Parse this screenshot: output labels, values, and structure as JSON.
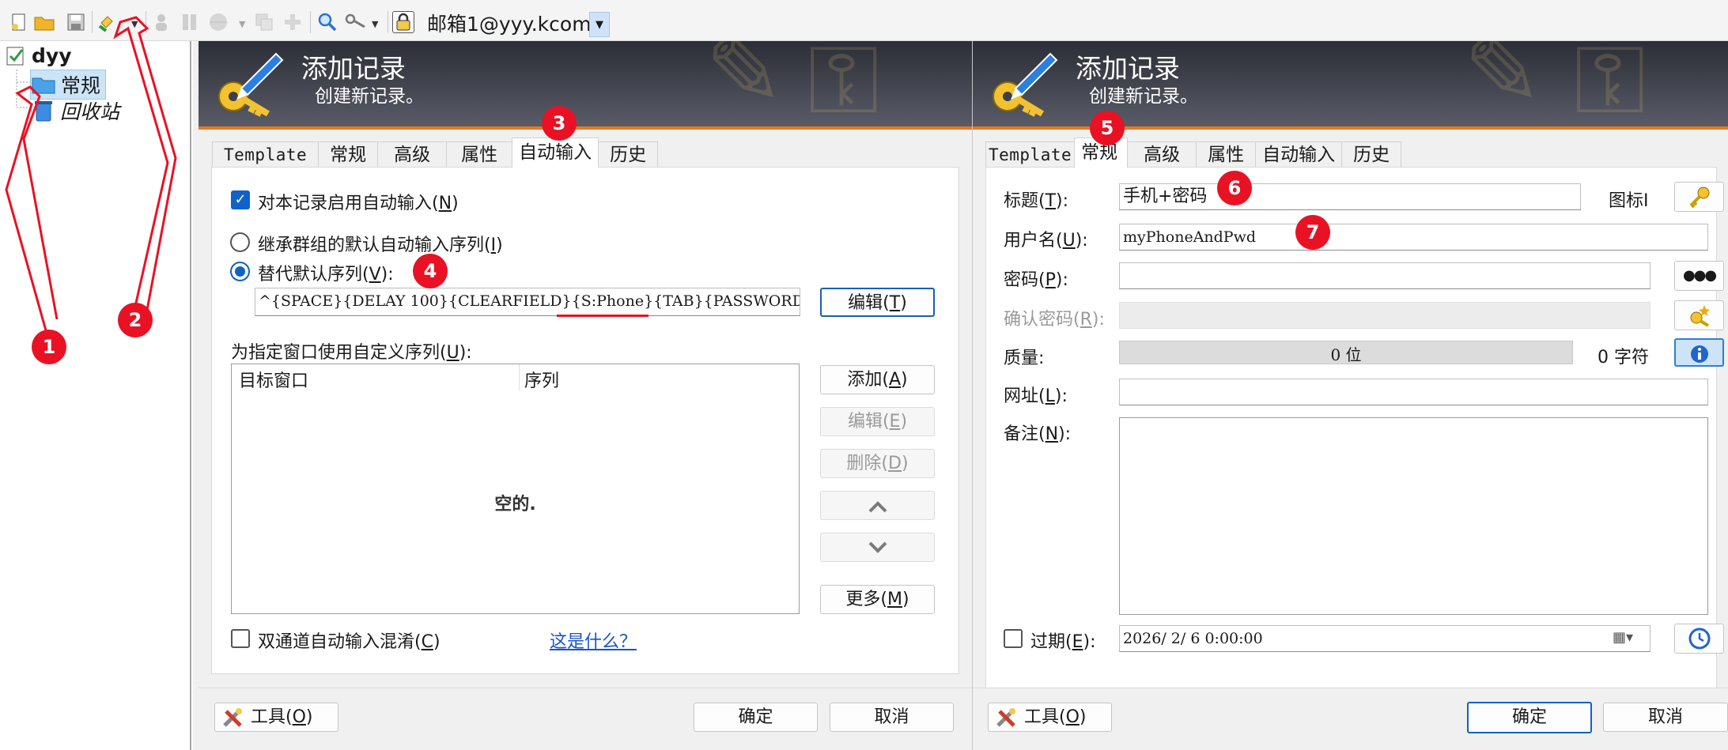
{
  "toolbar": {
    "database_name": "邮箱1@yyy.kcom"
  },
  "tree": {
    "root": "dyy",
    "items": [
      {
        "label": "常规"
      },
      {
        "label": "回收站"
      }
    ]
  },
  "dialog_left": {
    "title": "添加记录",
    "subtitle": "创建新记录。",
    "tabs": [
      "Template",
      "常规",
      "高级",
      "属性",
      "自动输入",
      "历史"
    ],
    "active_tab": "自动输入",
    "enable_autotype": {
      "prefix": "对本记录启用自动输入(",
      "key": "N",
      "suffix": ")",
      "checked": true
    },
    "inherit_option": {
      "prefix": "继承群组的默认自动输入序列(",
      "key": "I",
      "suffix": ")",
      "selected": false
    },
    "override_option": {
      "prefix": "替代默认序列(",
      "key": "V",
      "suffix": "):",
      "selected": true
    },
    "sequence": {
      "before": "^{SPACE}{DELAY 100}{CLEARFIELD}",
      "highlight": "{S:Phone}",
      "after": "{TAB}{PASSWORD}^{E"
    },
    "edit_button": {
      "prefix": "编辑(",
      "key": "T",
      "suffix": ")"
    },
    "custom_label": {
      "prefix": "为指定窗口使用自定义序列(",
      "key": "U",
      "suffix": "):"
    },
    "list_headers": [
      "目标窗口",
      "序列"
    ],
    "list_empty": "空的.",
    "side_buttons": [
      {
        "prefix": "添加(",
        "key": "A",
        "suffix": ")",
        "enabled": true
      },
      {
        "prefix": "编辑(",
        "key": "E",
        "suffix": ")",
        "enabled": false
      },
      {
        "prefix": "删除(",
        "key": "D",
        "suffix": ")",
        "enabled": false
      }
    ],
    "more_button": {
      "prefix": "更多(",
      "key": "M",
      "suffix": ")"
    },
    "obfuscation": {
      "prefix": "双通道自动输入混淆(",
      "key": "C",
      "suffix": ")",
      "checked": false
    },
    "help_link": "这是什么？",
    "tools_button": {
      "prefix": "工具(",
      "key": "O",
      "suffix": ")"
    },
    "ok_button": "确定",
    "cancel_button": "取消"
  },
  "dialog_right": {
    "title": "添加记录",
    "subtitle": "创建新记录。",
    "tabs": [
      "Template",
      "常规",
      "高级",
      "属性",
      "自动输入",
      "历史"
    ],
    "active_tab": "常规",
    "fields": {
      "title": {
        "prefix": "标题(",
        "key": "T",
        "suffix": "):",
        "value": "手机+密码"
      },
      "icon_label": "图标I",
      "username": {
        "prefix": "用户名(",
        "key": "U",
        "suffix": "):",
        "value": "myPhoneAndPwd"
      },
      "password": {
        "prefix": "密码(",
        "key": "P",
        "suffix": "):",
        "value": ""
      },
      "password_toggle": "●●●",
      "confirm": {
        "prefix": "确认密码(",
        "key": "R",
        "suffix": "):",
        "value": ""
      },
      "quality": {
        "label": "质量:",
        "bits": "0 位",
        "chars": "0 字符",
        "fraction": 0
      },
      "url": {
        "prefix": "网址(",
        "key": "L",
        "suffix": "):",
        "value": ""
      },
      "notes": {
        "prefix": "备注(",
        "key": "N",
        "suffix": "):",
        "value": ""
      },
      "expires": {
        "prefix": "过期(",
        "key": "E",
        "suffix": "):",
        "checked": false,
        "value": "2026/ 2/ 6  0:00:00"
      }
    },
    "tools_button": {
      "prefix": "工具(",
      "key": "O",
      "suffix": ")"
    },
    "ok_button": "确定",
    "cancel_button": "取消"
  },
  "markers": [
    "1",
    "2",
    "3",
    "4",
    "5",
    "6",
    "7"
  ],
  "colors": {
    "accent_orange": "#e8791d",
    "marker_red": "#e81224",
    "selection_blue": "#0f62c7",
    "banner_dark": "#2c2e37"
  }
}
